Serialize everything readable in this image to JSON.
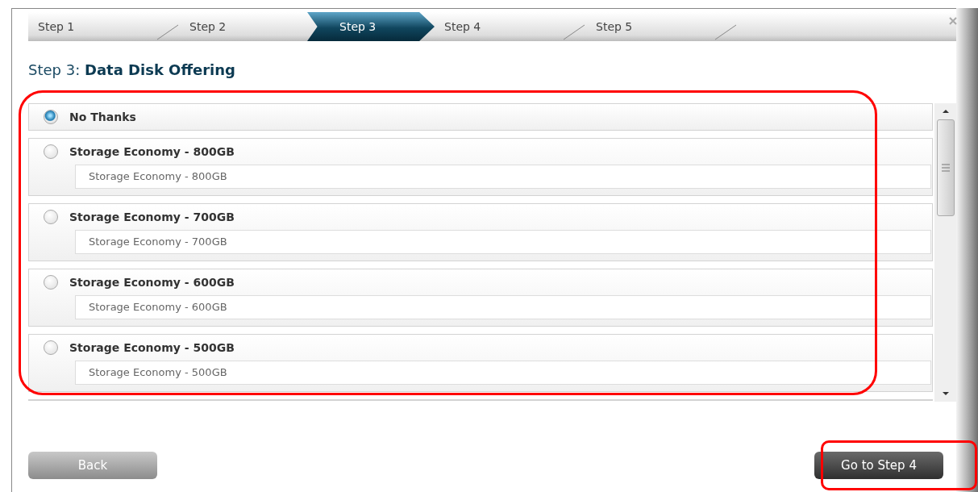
{
  "steps": [
    {
      "label": "Step 1",
      "selected": false
    },
    {
      "label": "Step 2",
      "selected": false
    },
    {
      "label": "Step 3",
      "selected": true
    },
    {
      "label": "Step 4",
      "selected": false
    },
    {
      "label": "Step 5",
      "selected": false
    }
  ],
  "heading": {
    "prefix": "Step 3:",
    "title": "Data Disk Offering"
  },
  "offerings": {
    "highlighted": true,
    "items": [
      {
        "name": "No Thanks",
        "selected": true
      },
      {
        "name": "Storage Economy - 800GB",
        "description": "Storage Economy - 800GB",
        "selected": false
      },
      {
        "name": "Storage Economy - 700GB",
        "description": "Storage Economy - 700GB",
        "selected": false
      },
      {
        "name": "Storage Economy - 600GB",
        "description": "Storage Economy - 600GB",
        "selected": false
      },
      {
        "name": "Storage Economy - 500GB",
        "description": "Storage Economy - 500GB",
        "selected": false
      }
    ]
  },
  "buttons": {
    "back": {
      "label": "Back"
    },
    "next": {
      "label": "Go to Step 4",
      "highlighted": true
    }
  }
}
